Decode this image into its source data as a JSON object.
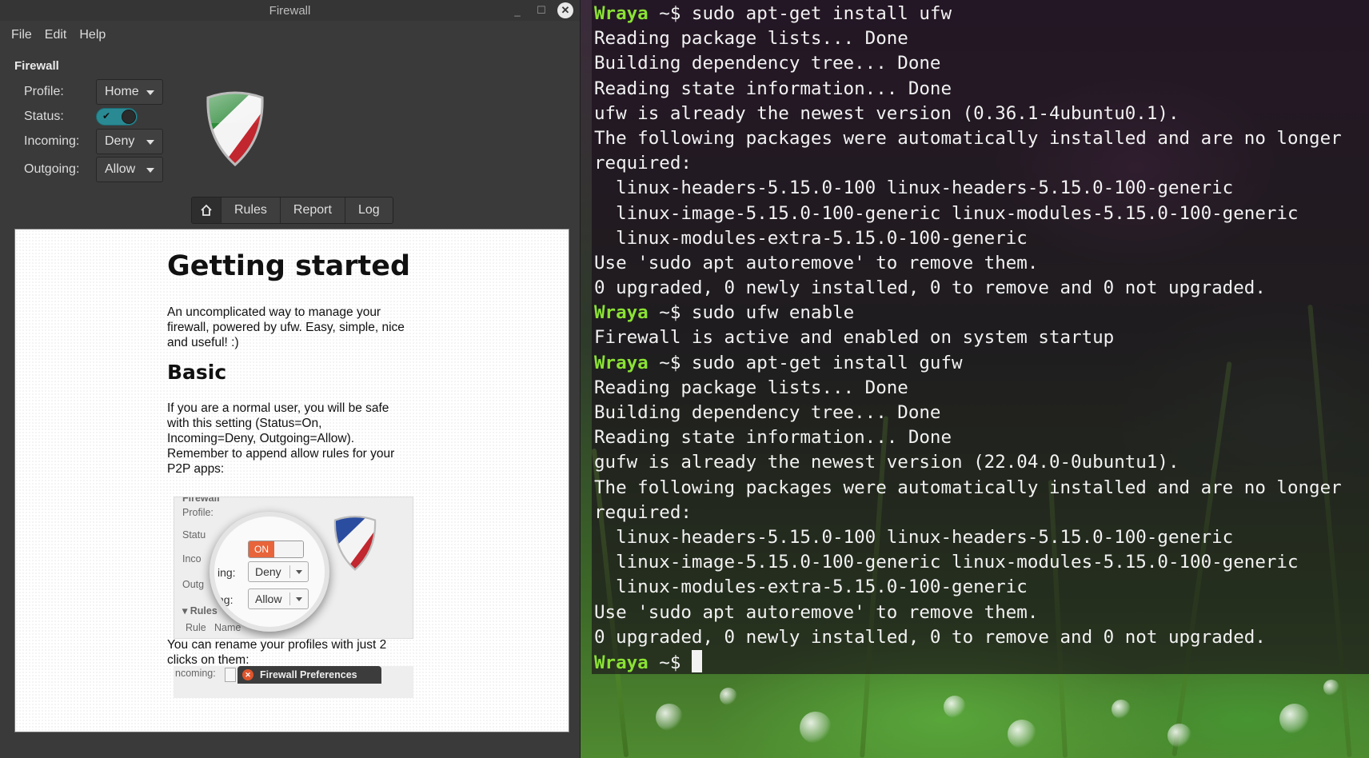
{
  "gufw": {
    "title": "Firewall",
    "window_controls": {
      "minimize": "_",
      "maximize": "☐",
      "close": "✕"
    },
    "menu": [
      "File",
      "Edit",
      "Help"
    ],
    "section_title": "Firewall",
    "profile": {
      "label": "Profile:",
      "value": "Home"
    },
    "status": {
      "label": "Status:",
      "on": true
    },
    "incoming": {
      "label": "Incoming:",
      "value": "Deny"
    },
    "outgoing": {
      "label": "Outgoing:",
      "value": "Allow"
    },
    "tabs": {
      "home_icon": "home-icon",
      "items": [
        "Rules",
        "Report",
        "Log"
      ]
    },
    "doc": {
      "heading": "Getting started",
      "intro": "An uncomplicated way to manage your firewall, powered by ufw. Easy, simple, nice and useful! :)",
      "basic_heading": "Basic",
      "basic_text": "If you are a normal user, you will be safe with this setting (Status=On, Incoming=Deny, Outgoing=Allow). Remember to append allow rules for your P2P apps:",
      "screenshot1": {
        "header": "Firewall",
        "labels": [
          "Profile:",
          "Statu",
          "Inco",
          "Outg"
        ],
        "mag_on": "ON",
        "mag_labels": [
          "ing:",
          "ng:"
        ],
        "mag_incoming": "Deny",
        "mag_outgoing": "Allow",
        "rules_header": "Rules",
        "columns": [
          "Rule",
          "Name"
        ]
      },
      "rename_text": "You can rename your profiles with just 2 clicks on them:",
      "screenshot2": {
        "label": "ncoming:",
        "prefs_title": "Firewall Preferences"
      }
    }
  },
  "terminal": {
    "user": "Wraya",
    "prompt_suffix": " ~$ ",
    "lines": [
      {
        "type": "prompt",
        "cmd": "sudo apt-get install ufw"
      },
      {
        "type": "out",
        "text": "Reading package lists... Done"
      },
      {
        "type": "out",
        "text": "Building dependency tree... Done"
      },
      {
        "type": "out",
        "text": "Reading state information... Done"
      },
      {
        "type": "out",
        "text": "ufw is already the newest version (0.36.1-4ubuntu0.1)."
      },
      {
        "type": "out",
        "text": "The following packages were automatically installed and are no longer"
      },
      {
        "type": "out",
        "text": "required:"
      },
      {
        "type": "out",
        "text": "  linux-headers-5.15.0-100 linux-headers-5.15.0-100-generic"
      },
      {
        "type": "out",
        "text": "  linux-image-5.15.0-100-generic linux-modules-5.15.0-100-generic"
      },
      {
        "type": "out",
        "text": "  linux-modules-extra-5.15.0-100-generic"
      },
      {
        "type": "out",
        "text": "Use 'sudo apt autoremove' to remove them."
      },
      {
        "type": "out",
        "text": "0 upgraded, 0 newly installed, 0 to remove and 0 not upgraded."
      },
      {
        "type": "prompt",
        "cmd": "sudo ufw enable"
      },
      {
        "type": "out",
        "text": "Firewall is active and enabled on system startup"
      },
      {
        "type": "prompt",
        "cmd": "sudo apt-get install gufw"
      },
      {
        "type": "out",
        "text": "Reading package lists... Done"
      },
      {
        "type": "out",
        "text": "Building dependency tree... Done"
      },
      {
        "type": "out",
        "text": "Reading state information... Done"
      },
      {
        "type": "out",
        "text": "gufw is already the newest version (22.04.0-0ubuntu1)."
      },
      {
        "type": "out",
        "text": "The following packages were automatically installed and are no longer"
      },
      {
        "type": "out",
        "text": "required:"
      },
      {
        "type": "out",
        "text": "  linux-headers-5.15.0-100 linux-headers-5.15.0-100-generic"
      },
      {
        "type": "out",
        "text": "  linux-image-5.15.0-100-generic linux-modules-5.15.0-100-generic"
      },
      {
        "type": "out",
        "text": "  linux-modules-extra-5.15.0-100-generic"
      },
      {
        "type": "out",
        "text": "Use 'sudo apt autoremove' to remove them."
      },
      {
        "type": "out",
        "text": "0 upgraded, 0 newly installed, 0 to remove and 0 not upgraded."
      },
      {
        "type": "prompt",
        "cmd": "",
        "cursor": true
      }
    ]
  }
}
